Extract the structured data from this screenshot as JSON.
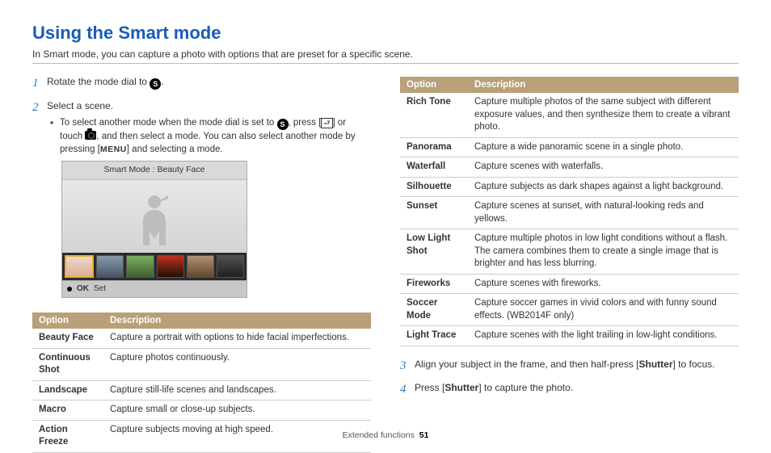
{
  "heading": "Using the Smart mode",
  "intro": "In Smart mode, you can capture a photo with options that are preset for a specific scene.",
  "steps": {
    "s1": {
      "num": "1",
      "text_pre": "Rotate the mode dial to ",
      "text_post": "."
    },
    "s2": {
      "num": "2",
      "text": "Select a scene.",
      "bullet_a": "To select another mode when the mode dial is set to ",
      "bullet_b": ", press [",
      "bullet_c": "] or touch ",
      "bullet_d": ", and then select a mode. You can also select another mode by pressing [",
      "bullet_e": "] and selecting a mode."
    },
    "s3": {
      "num": "3",
      "pre": "Align your subject in the frame, and then half-press [",
      "bold": "Shutter",
      "post": "] to focus."
    },
    "s4": {
      "num": "4",
      "pre": "Press [",
      "bold": "Shutter",
      "post": "] to capture the photo."
    }
  },
  "screenshot": {
    "title": "Smart Mode : Beauty Face",
    "ok": "OK",
    "set": "Set"
  },
  "table_headers": {
    "option": "Option",
    "description": "Description"
  },
  "left_table": [
    {
      "o": "Beauty Face",
      "d": "Capture a portrait with options to hide facial imperfections."
    },
    {
      "o": "Continuous Shot",
      "d": "Capture photos continuously."
    },
    {
      "o": "Landscape",
      "d": "Capture still-life scenes and landscapes."
    },
    {
      "o": "Macro",
      "d": "Capture small or close-up subjects."
    },
    {
      "o": "Action Freeze",
      "d": "Capture subjects moving at high speed."
    }
  ],
  "right_table": [
    {
      "o": "Rich Tone",
      "d": "Capture multiple photos of the same subject with different exposure values, and then synthesize them to create a vibrant photo."
    },
    {
      "o": "Panorama",
      "d": "Capture a wide panoramic scene in a single photo."
    },
    {
      "o": "Waterfall",
      "d": "Capture scenes with waterfalls."
    },
    {
      "o": "Silhouette",
      "d": "Capture subjects as dark shapes against a light background."
    },
    {
      "o": "Sunset",
      "d": "Capture scenes at sunset, with natural-looking reds and yellows."
    },
    {
      "o": "Low Light Shot",
      "d": "Capture multiple photos in low light conditions without a flash. The camera combines them to create a single image that is brighter and has less blurring."
    },
    {
      "o": "Fireworks",
      "d": "Capture scenes with fireworks."
    },
    {
      "o": "Soccer Mode",
      "d": "Capture soccer games in vivid colors and with funny sound effects. (WB2014F only)"
    },
    {
      "o": "Light Trace",
      "d": "Capture scenes with the light trailing in low-light conditions."
    }
  ],
  "menu_label": "MENU",
  "icon_s": "S",
  "footer": {
    "section": "Extended functions",
    "page": "51"
  }
}
